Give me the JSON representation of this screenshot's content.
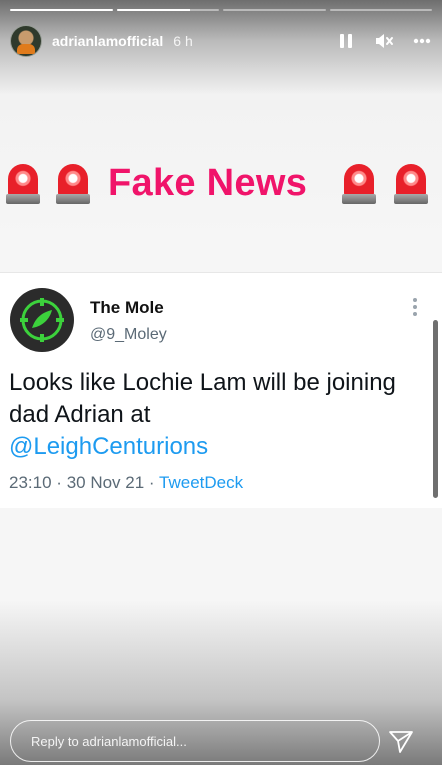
{
  "story": {
    "progress": [
      1,
      0.72,
      0,
      0
    ],
    "username": "adrianlamofficial",
    "time_ago": "6 h",
    "icons": {
      "pause": "pause-icon",
      "mute": "mute-icon",
      "more": "more-icon",
      "siren": "police-light-icon",
      "send": "send-icon"
    }
  },
  "banner": {
    "title": "Fake News"
  },
  "tweet": {
    "name": "The Mole",
    "handle": "@9_Moley",
    "text_line": "Looks like Lochie Lam will be joining dad Adrian at",
    "mention": "@LeighCenturions",
    "time": "23:10",
    "date": "30 Nov 21",
    "separator": "·",
    "source": "TweetDeck"
  },
  "reply": {
    "placeholder": "Reply to adrianlamofficial..."
  },
  "colors": {
    "fake_news": "#f0146a",
    "link": "#1d9bf0"
  }
}
